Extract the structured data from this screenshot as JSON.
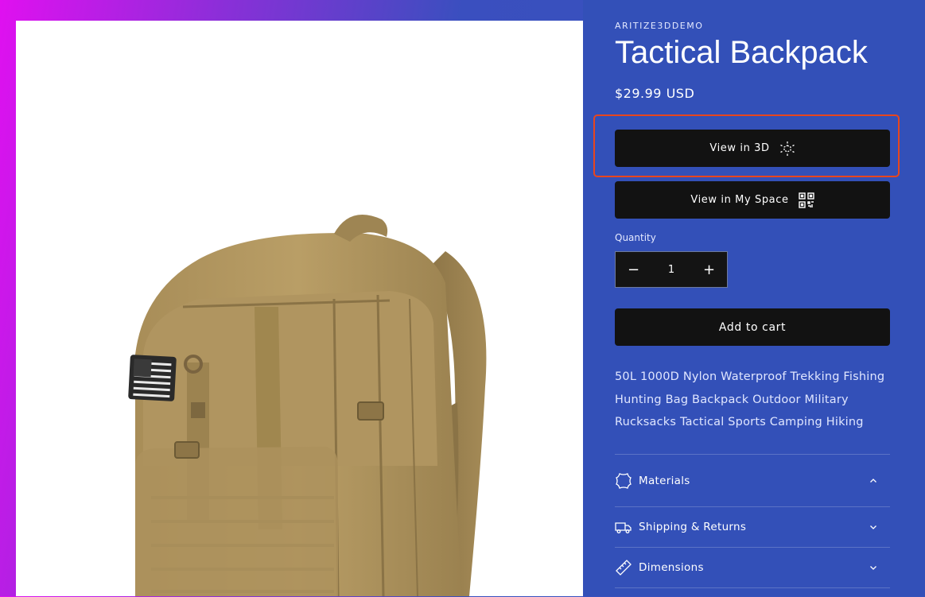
{
  "product": {
    "vendor": "ARITIZE3DDEMO",
    "title": "Tactical Backpack",
    "price": "$29.99 USD",
    "image_subject": "tan tactical backpack with flag patch",
    "description": "50L 1000D Nylon Waterproof Trekking Fishing Hunting Bag Backpack Outdoor Military Rucksacks Tactical Sports Camping Hiking"
  },
  "buttons": {
    "view_3d": "View in 3D",
    "view_space": "View in My Space",
    "add_to_cart": "Add to cart"
  },
  "quantity": {
    "label": "Quantity",
    "value": "1",
    "decrease_symbol": "−",
    "increase_symbol": "+"
  },
  "accordions": [
    {
      "label": "Materials",
      "icon": "leather-icon",
      "state": "expanded"
    },
    {
      "label": "Shipping & Returns",
      "icon": "truck-icon",
      "state": "collapsed"
    },
    {
      "label": "Dimensions",
      "icon": "ruler-icon",
      "state": "collapsed"
    }
  ],
  "colors": {
    "panel_bg": "#3350b8",
    "button_bg": "#121212",
    "highlight_border": "#e8461d",
    "backpack_tan": "#b59a62"
  }
}
